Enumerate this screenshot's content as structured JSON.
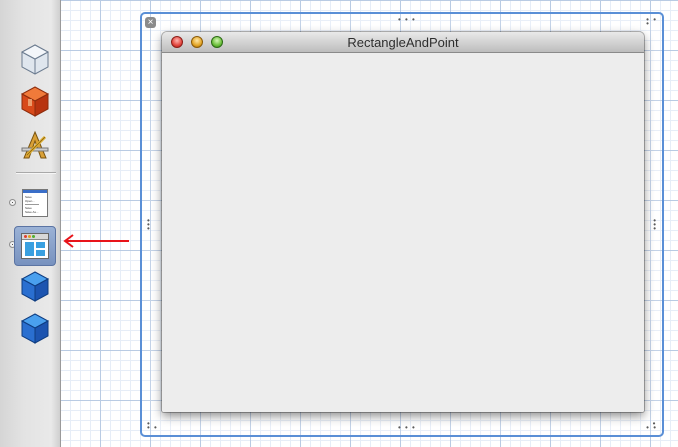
{
  "dock": {
    "items": [
      {
        "icon": "object-cube-outline-icon"
      },
      {
        "icon": "red-cube-icon"
      },
      {
        "icon": "app-pencil-icon"
      },
      {
        "icon": "menu-object-icon",
        "menu_lines": [
          "Save",
          "Open...",
          "Save",
          "Save As..."
        ]
      },
      {
        "icon": "window-object-icon",
        "selected": true
      },
      {
        "icon": "blue-cube-icon"
      },
      {
        "icon": "blue-cube-icon"
      }
    ]
  },
  "annotation": {
    "arrow_color": "#e8141a"
  },
  "window": {
    "title": "RectangleAndPoint"
  },
  "colors": {
    "selection_border": "#5a8fd6",
    "grid_major": "#b9cbe3",
    "grid_minor": "#e6edf7"
  }
}
